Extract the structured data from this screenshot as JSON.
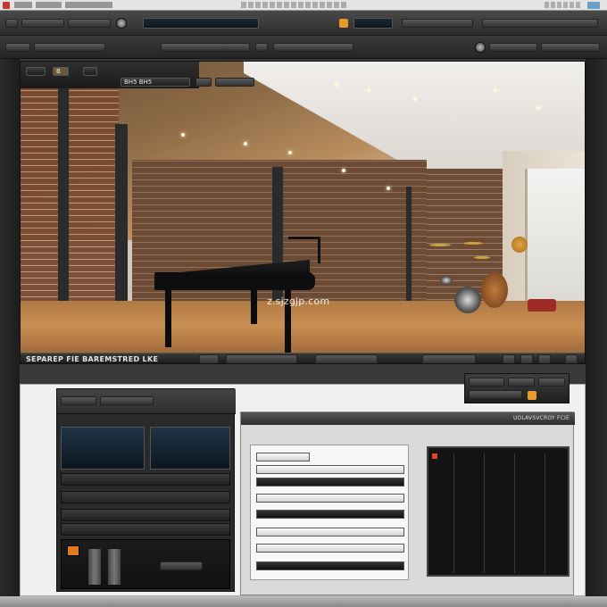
{
  "window": {
    "photo_bottom_label": "SEPAREP FIE BAREMSTRED LKE",
    "watermark": "z.sjzgjp.com",
    "photo_overlay": {
      "tag_1": "B",
      "tag_2": "BH5 BH5"
    },
    "right_window_title": "UOLAVSVCROY FCIE"
  },
  "colors": {
    "accent": "#e89a2a",
    "window_icon": "#6aa0c8",
    "brand_red": "#c43a2a"
  }
}
